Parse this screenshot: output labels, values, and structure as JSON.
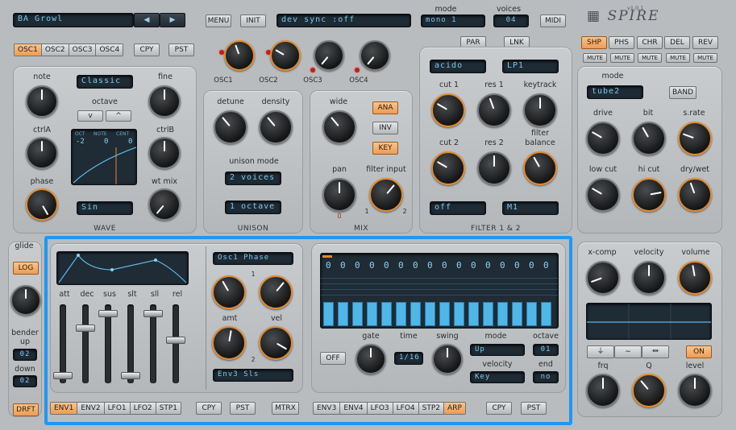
{
  "header": {
    "preset_name": "BA Growl",
    "menu_label": "MENU",
    "init_label": "INIT",
    "display_text": "dev sync      :off",
    "mode_title": "mode",
    "mode_value": "mono 1",
    "voices_title": "voices",
    "voices_value": "04",
    "midi_label": "MIDI",
    "logo_text": "SPIRE",
    "version": "v1.0.1"
  },
  "osc": {
    "tabs": [
      "OSC1",
      "OSC2",
      "OSC3",
      "OSC4"
    ],
    "copy_label": "CPY",
    "paste_label": "PST",
    "mix_labels": [
      "OSC1",
      "OSC2",
      "OSC3",
      "OSC4"
    ],
    "note_label": "note",
    "fine_label": "fine",
    "mode_value": "Classic",
    "octave_label": "octave",
    "octave_down": "v",
    "octave_up": "^",
    "ctrlA_label": "ctrlA",
    "ctrlB_label": "ctrlB",
    "phase_label": "phase",
    "wtmix_label": "wt mix",
    "oct_title": "OCT",
    "note_title": "NOTE",
    "cent_title": "CENT",
    "oct_value": "-2",
    "note_value": "0",
    "cent_value": "0",
    "wave_value": "Sin",
    "wave_section": "WAVE"
  },
  "unison": {
    "detune_label": "detune",
    "density_label": "density",
    "mode_label": "unison mode",
    "voices_value": "2 voices",
    "octave_value": "1 octave",
    "section": "UNISON"
  },
  "mix": {
    "wide_label": "wide",
    "ana_label": "ANA",
    "inv_label": "INV",
    "key_label": "KEY",
    "pan_label": "pan",
    "filter_input_label": "filter input",
    "input_1": "1",
    "input_2": "2",
    "pan_marker": "0",
    "section": "MIX"
  },
  "filter": {
    "par_label": "PAR",
    "lnk_label": "LNK",
    "type1": "acido",
    "type2": "LP1",
    "cut1_label": "cut 1",
    "res1_label": "res 1",
    "keytrack_label": "keytrack",
    "cut2_label": "cut 2",
    "res2_label": "res 2",
    "balance_label": "filter balance",
    "mode1": "off",
    "mode2": "M1",
    "section": "FILTER 1 & 2"
  },
  "fx": {
    "tabs": [
      "SHP",
      "PHS",
      "CHR",
      "DEL",
      "REV"
    ],
    "mute_label": "MUTE",
    "mode_label": "mode",
    "mode_value": "tube2",
    "band_label": "BAND",
    "drive_label": "drive",
    "bit_label": "bit",
    "srate_label": "s.rate",
    "lowcut_label": "low cut",
    "hicut_label": "hi cut",
    "drywet_label": "dry/wet"
  },
  "master": {
    "xcomp_label": "x-comp",
    "velocity_label": "velocity",
    "volume_label": "volume",
    "on_label": "ON",
    "frq_label": "frq",
    "q_label": "Q",
    "level_label": "level"
  },
  "left": {
    "glide_label": "glide",
    "log_label": "LOG",
    "bender_up_label": "bender up",
    "bender_up_value": "02",
    "down_label": "down",
    "down_value": "02",
    "drft_label": "DRFT"
  },
  "envelope": {
    "labels": [
      "att",
      "dec",
      "sus",
      "slt",
      "sll",
      "rel"
    ],
    "fader_levels": [
      0.05,
      0.72,
      0.92,
      0.05,
      0.92,
      0.55
    ],
    "dest1": "Osc1 Phase",
    "amt_label": "amt",
    "vel_label": "vel",
    "slot1": "1",
    "slot2": "2",
    "dest2": "Env3 Sls",
    "tabs": [
      "ENV1",
      "ENV2",
      "LFO1",
      "LFO2",
      "STP1"
    ],
    "copy_label": "CPY",
    "paste_label": "PST",
    "matrix_label": "MTRX"
  },
  "arp": {
    "step_values": [
      "0",
      "0",
      "0",
      "0",
      "0",
      "0",
      "0",
      "0",
      "0",
      "0",
      "0",
      "0",
      "0",
      "0",
      "0",
      "0"
    ],
    "step_levels": [
      1,
      1,
      1,
      1,
      1,
      1,
      1,
      1,
      1,
      1,
      1,
      1,
      1,
      1,
      1,
      1
    ],
    "off_label": "OFF",
    "gate_label": "gate",
    "time_label": "time",
    "time_value": "1/16",
    "swing_label": "swing",
    "mode_label": "mode",
    "mode_value": "Up",
    "octave_label": "octave",
    "octave_value": "01",
    "velocity_label": "velocity",
    "velocity_value": "Key",
    "end_label": "end",
    "end_value": "no",
    "tabs": [
      "ENV3",
      "ENV4",
      "LFO3",
      "LFO4",
      "STP2",
      "ARP"
    ],
    "copy_label": "CPY",
    "paste_label": "PST"
  },
  "colors": {
    "accent": "#ec9d56",
    "lcd_text": "#7fc7ea",
    "highlight": "#2196f3",
    "step_bar": "#4fb6e8"
  }
}
